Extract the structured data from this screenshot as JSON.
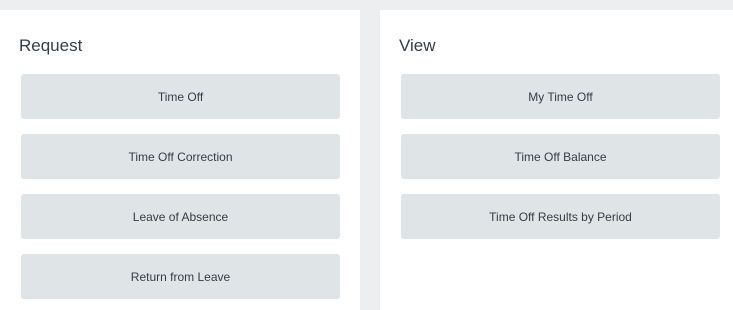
{
  "request": {
    "title": "Request",
    "buttons": [
      {
        "label": "Time Off"
      },
      {
        "label": "Time Off Correction"
      },
      {
        "label": "Leave of Absence"
      },
      {
        "label": "Return from Leave"
      }
    ]
  },
  "view": {
    "title": "View",
    "buttons": [
      {
        "label": "My Time Off"
      },
      {
        "label": "Time Off Balance"
      },
      {
        "label": "Time Off Results by Period"
      }
    ]
  }
}
